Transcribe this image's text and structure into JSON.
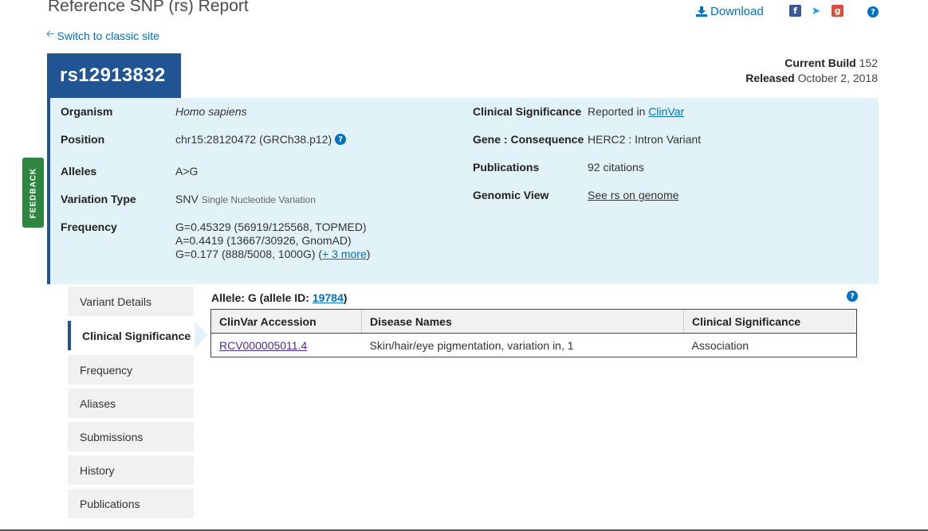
{
  "header": {
    "title": "Reference SNP (rs) Report",
    "classic_link": "Switch to classic site",
    "download": "Download"
  },
  "rsid": "rs12913832",
  "build": {
    "build_label": "Current Build",
    "build_value": "152",
    "released_label": "Released",
    "released_value": "October 2, 2018"
  },
  "summary": {
    "organism_label": "Organism",
    "organism_value": "Homo sapiens",
    "position_label": "Position",
    "position_value": "chr15:28120472 (GRCh38.p12)",
    "alleles_label": "Alleles",
    "alleles_value": "A>G",
    "variation_type_label": "Variation Type",
    "variation_type_value": "SNV",
    "variation_type_desc": "Single Nucleotide Variation",
    "frequency_label": "Frequency",
    "frequency_lines": [
      "G=0.45329 (56919/125568, TOPMED)",
      "A=0.4419 (13667/30926, GnomAD)",
      "G=0.177 (888/5008, 1000G)"
    ],
    "frequency_more": "+ 3 more",
    "clinical_label": "Clinical Significance",
    "clinical_value_prefix": "Reported in",
    "clinical_value_link": "ClinVar",
    "gene_label": "Gene : Consequence",
    "gene_value": "HERC2 : Intron Variant",
    "publications_label": "Publications",
    "publications_value": "92 citations",
    "genomic_label": "Genomic View",
    "genomic_value": "See rs on genome"
  },
  "feedback": "FEEDBACK",
  "nav": {
    "items": [
      {
        "label": "Variant Details"
      },
      {
        "label": "Clinical Significance"
      },
      {
        "label": "Frequency"
      },
      {
        "label": "Aliases"
      },
      {
        "label": "Submissions"
      },
      {
        "label": "History"
      },
      {
        "label": "Publications"
      }
    ],
    "active": "Clinical Significance"
  },
  "allele": {
    "title_prefix": "Allele: G (allele ID:",
    "allele_id": "19784",
    "title_suffix": ")"
  },
  "clinvar_table": {
    "headers": [
      "ClinVar Accession",
      "Disease Names",
      "Clinical Significance"
    ],
    "rows": [
      [
        "RCV000005011.4",
        "Skin/hair/eye pigmentation, variation in, 1",
        "Association"
      ]
    ]
  },
  "colors": {
    "brand_blue": "#205493",
    "link_blue": "#0071bc",
    "panel_bg": "#e1f3f8",
    "feedback_green": "#2e8540"
  }
}
